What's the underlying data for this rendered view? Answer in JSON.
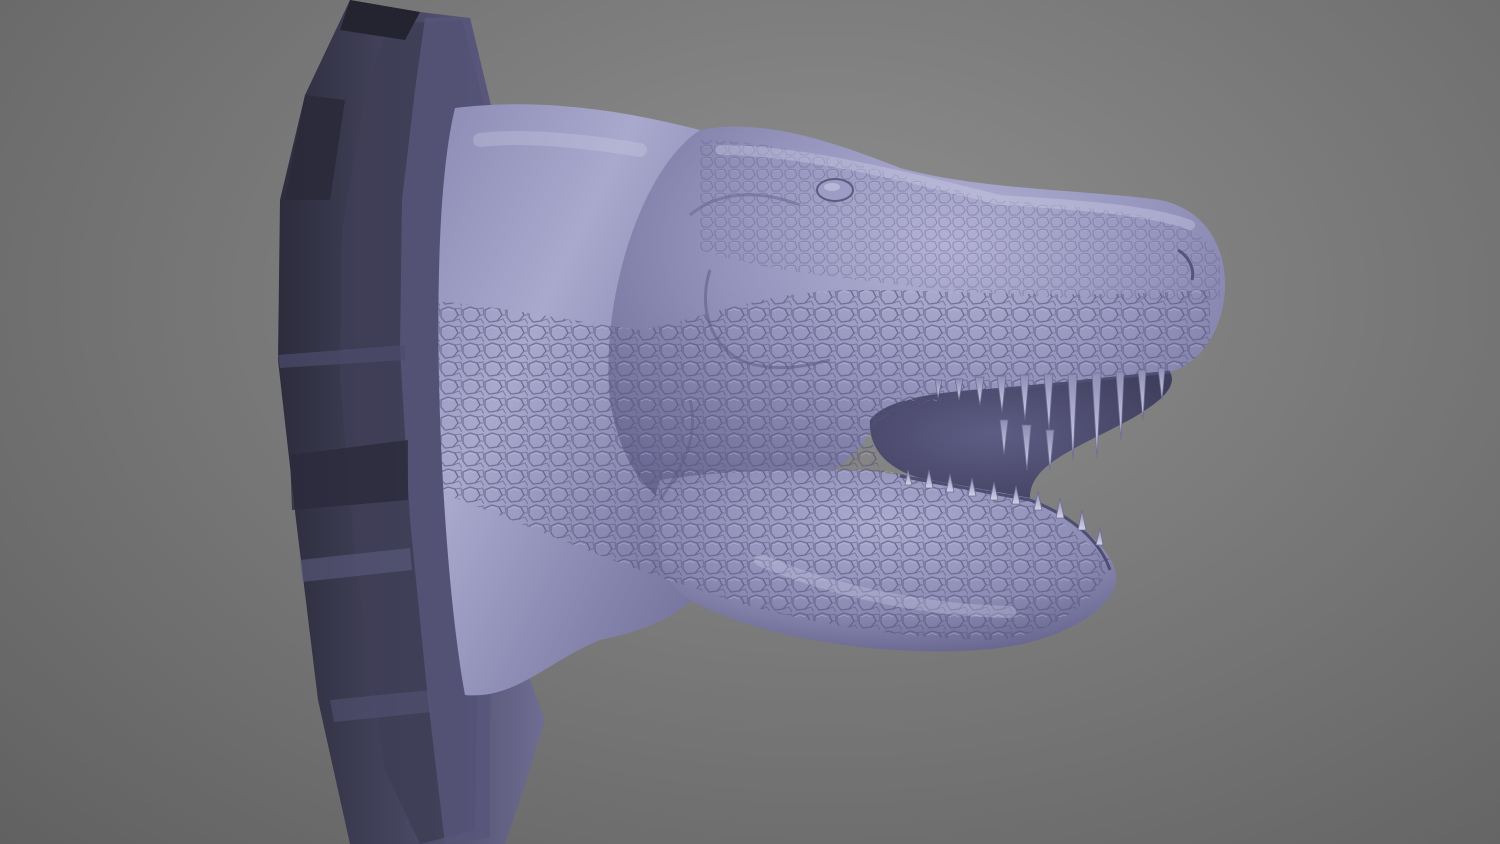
{
  "viewport": {
    "background_top": "#8f8f8f",
    "background_bottom": "#616161"
  },
  "model": {
    "subject": "dinosaur-head-wall-mount",
    "material_color": "#8a89b4",
    "material_highlight": "#b9b8d8",
    "material_shadow": "#4d4b70",
    "plaque_color": "#3a3a4e",
    "plaque_highlight": "#6b6a8e"
  }
}
